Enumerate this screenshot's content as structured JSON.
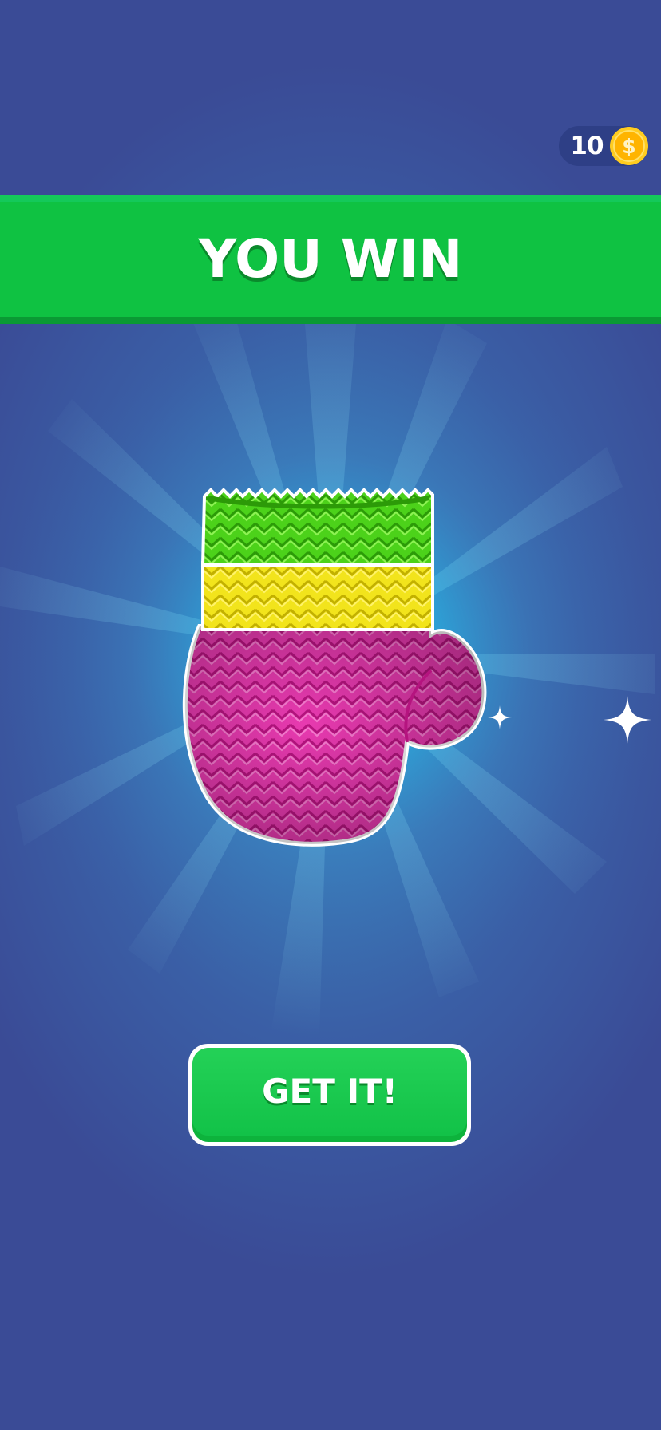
{
  "hud": {
    "coins": "10",
    "coin_icon": "dollar-coin-icon",
    "coin_symbol": "$"
  },
  "banner": {
    "title": "YOU WIN"
  },
  "reward": {
    "item_icon": "knitted-mitten-icon",
    "stripe_colors": [
      "#4cd21a",
      "#f2e41c",
      "#e83ab0"
    ]
  },
  "actions": {
    "claim_label": "GET IT!"
  },
  "colors": {
    "background": "#3a4b96",
    "banner": "#0fc242",
    "button": "#12c248",
    "coin": "#ffb400"
  }
}
